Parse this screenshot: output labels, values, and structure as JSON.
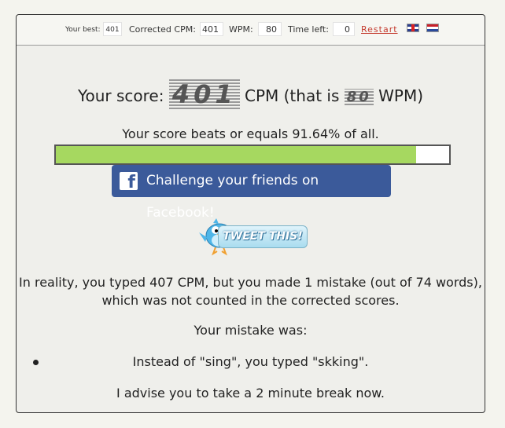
{
  "topbar": {
    "best_label": "Your best:",
    "best_value": "401",
    "corrected_label": "Corrected CPM:",
    "corrected_value": "401",
    "wpm_label": "WPM:",
    "wpm_value": "80",
    "time_label": "Time left:",
    "time_value": "0",
    "restart_label": "Restart",
    "languages": [
      "english-flag-icon",
      "dutch-flag-icon"
    ]
  },
  "score": {
    "prefix": "Your score:",
    "cpm": "401",
    "cpm_unit": "CPM (that is",
    "wpm": "80",
    "wpm_unit": "WPM)"
  },
  "percentile": {
    "text": "Your score beats or equals 91.64% of all.",
    "fill_fraction": 0.9164
  },
  "facebook_button": {
    "label": "Challenge your friends on Facebook!",
    "icon": "facebook-icon"
  },
  "tweet_button": {
    "label": "TWEET THIS!",
    "icon": "twitter-bird-icon"
  },
  "reality": "In reality, you typed 407 CPM, but you made 1 mistake (out of 74 words), which was not counted in the corrected scores.",
  "mistake_heading": "Your mistake was:",
  "mistakes": [
    "Instead of \"sing\", you typed \"skking\"."
  ],
  "advice": "I advise you to take a 2 minute break now.",
  "colors": {
    "progress": "#a6d860",
    "facebook": "#3b5a9a",
    "restart_link": "#c43a2e"
  }
}
